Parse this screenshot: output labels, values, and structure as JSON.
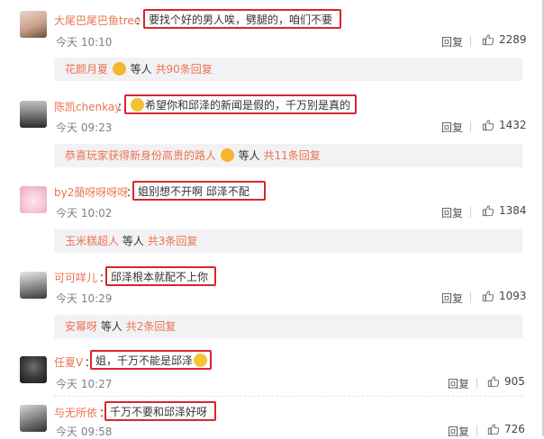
{
  "comments": [
    {
      "username": "大尾巴尾巴鱼tree",
      "separator": "：",
      "text": "要找个好的男人唉，劈腿的，咱们不要",
      "time": "今天 10:10",
      "reply_label": "回复",
      "likes": "2289",
      "subreplies": {
        "names": "花颜月夏",
        "middle": "等人",
        "count": "共90条回复"
      }
    },
    {
      "username": "陈凯chenkay",
      "separator": "：",
      "text": "希望你和邱泽的新闻是假的，千万别是真的",
      "time": "今天 09:23",
      "reply_label": "回复",
      "likes": "1432",
      "subreplies": {
        "names": "恭喜玩家获得新身份高贵的路人",
        "middle": "等人",
        "count": "共11条回复"
      }
    },
    {
      "username": "by2蕑呀呀呀呀",
      "separator": "：",
      "text": "姐别想不开啊 邱泽不配",
      "time": "今天 10:02",
      "reply_label": "回复",
      "likes": "1384",
      "subreplies": {
        "names": "玉米糕超人",
        "middle": "等人",
        "count": "共3条回复"
      }
    },
    {
      "username": "可可咩儿",
      "separator": "：",
      "text": "邱泽根本就配不上你",
      "time": "今天 10:29",
      "reply_label": "回复",
      "likes": "1093",
      "subreplies": {
        "names": "安幂呀",
        "middle": "等人",
        "count": "共2条回复"
      }
    },
    {
      "username": "任夏V",
      "separator": "：",
      "text": "姐，千万不能是邱泽",
      "time": "今天 10:27",
      "reply_label": "回复",
      "likes": "905"
    },
    {
      "username": "与无所依",
      "separator": "：",
      "text": "千万不要和邱泽好呀",
      "time": "今天 09:58",
      "reply_label": "回复",
      "likes": "726"
    }
  ],
  "colors": {
    "username": "#eb7350",
    "highlight_border": "#d9262c",
    "subbar_bg": "#f2f2f5",
    "meta": "#808080"
  },
  "icons": {
    "like": "thumb-up-icon",
    "emoji_crying_laugh": "crying-laugh-emoji-icon",
    "emoji_thinking": "thinking-emoji-icon",
    "emoji_crown": "crown-emoji-icon"
  }
}
